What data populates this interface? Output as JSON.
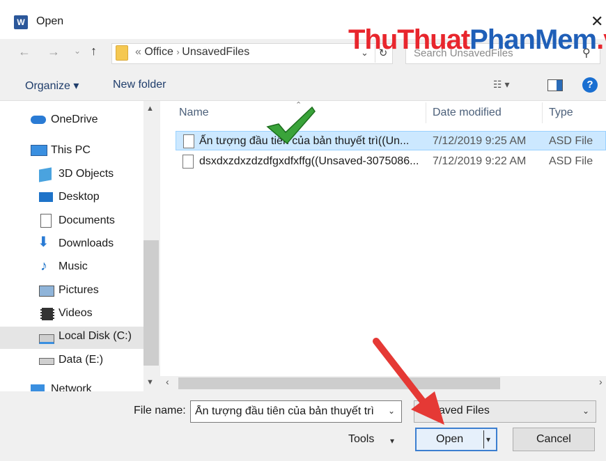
{
  "window": {
    "title": "Open",
    "app_icon": "W"
  },
  "watermark": {
    "part1": "ThuThuat",
    "part2": "PhanMem",
    "part3": ".vn"
  },
  "address": {
    "prefix": "«",
    "crumbs": [
      "Office",
      "UnsavedFiles"
    ]
  },
  "search": {
    "placeholder": "Search UnsavedFiles"
  },
  "toolbar": {
    "organize": "Organize ▾",
    "new_folder": "New folder"
  },
  "nav": {
    "items": [
      {
        "label": "OneDrive",
        "icon": "onedrive-icon"
      },
      {
        "label": "This PC",
        "icon": "this-pc-icon"
      },
      {
        "label": "3D Objects",
        "icon": "3d-objects-icon"
      },
      {
        "label": "Desktop",
        "icon": "desktop-icon"
      },
      {
        "label": "Documents",
        "icon": "documents-icon"
      },
      {
        "label": "Downloads",
        "icon": "downloads-icon"
      },
      {
        "label": "Music",
        "icon": "music-icon"
      },
      {
        "label": "Pictures",
        "icon": "pictures-icon"
      },
      {
        "label": "Videos",
        "icon": "videos-icon"
      },
      {
        "label": "Local Disk (C:)",
        "icon": "local-disk-icon"
      },
      {
        "label": "Data (E:)",
        "icon": "drive-icon"
      },
      {
        "label": "Network",
        "icon": "network-icon"
      }
    ],
    "selected": "Local Disk (C:)"
  },
  "files": {
    "columns": [
      "Name",
      "Date modified",
      "Type"
    ],
    "rows": [
      {
        "name": "Ấn tượng đầu tiên của bản thuyết trì((Un...",
        "date": "7/12/2019 9:25 AM",
        "type": "ASD File"
      },
      {
        "name": "dsxdxzdxzdzdfgxdfxffg((Unsaved-3075086...",
        "date": "7/12/2019 9:22 AM",
        "type": "ASD File"
      }
    ]
  },
  "bottom": {
    "file_name_label": "File name:",
    "file_name_value": "Ấn tượng đầu tiên của bản thuyết trì",
    "file_type_value": "aved Files",
    "tools_label": "Tools",
    "open_label": "Open",
    "cancel_label": "Cancel"
  },
  "colors": {
    "accent": "#3c7fd0",
    "selection": "#cce8ff",
    "arrow": "#e53935",
    "check": "#3aa33a"
  }
}
